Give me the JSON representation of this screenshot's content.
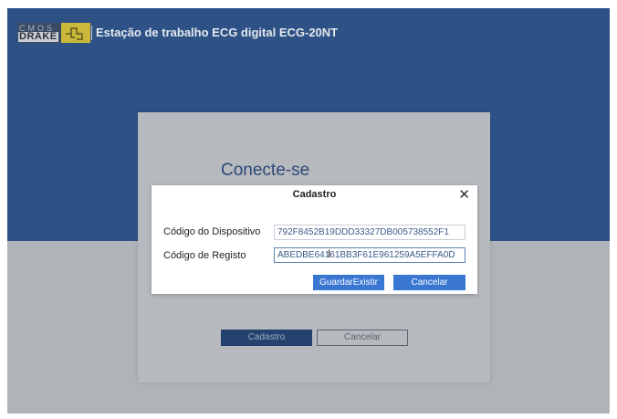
{
  "app": {
    "logo_top": "CMOS",
    "logo_bottom": "DRAKE",
    "title": "Estação de trabalho ECG digital ECG-20NT"
  },
  "login": {
    "title": "Conecte-se",
    "register_button": "Cadastro",
    "cancel_button": "Cancelar"
  },
  "dialog": {
    "title": "Cadastro",
    "close_glyph": "✕",
    "device_code_label": "Código do Dispositivo",
    "device_code_value": "792F8452B19DDD33327DB005738552F1",
    "registration_code_label": "Código de Registo",
    "registration_code_value": "ABEDBE64161BB3F61E961259A5EFFA0D",
    "save_button": "GuardarExistir",
    "cancel_button": "Cancelar"
  },
  "colors": {
    "header_blue": "#2e5285",
    "accent_button": "#3a77d2",
    "dark_button": "#24426d"
  }
}
